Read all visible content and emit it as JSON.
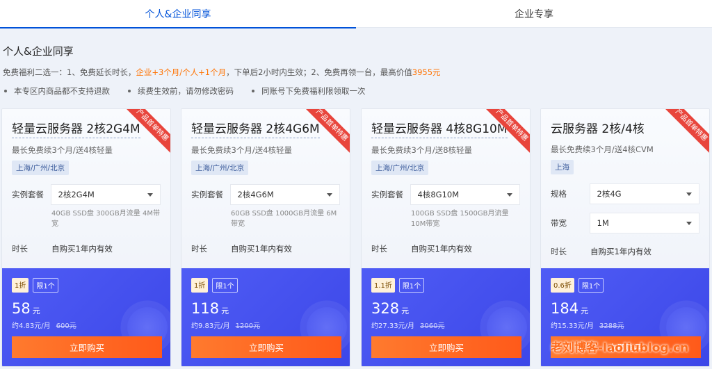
{
  "tabs": [
    {
      "label": "个人&企业同享",
      "active": true
    },
    {
      "label": "企业专享",
      "active": false
    }
  ],
  "section_title": "个人&企业同享",
  "benefit": {
    "prefix": "免费福利二选一：1、免费延长时长，",
    "highlight1": "企业+3个月/个人+1个月",
    "middle": "，下单后2小时内生效；2、免费再领一台，最高价值",
    "highlight2": "3955元"
  },
  "notes": [
    "本专区内商品都不支持退款",
    "续费生效前，请勿修改密码",
    "同账号下免费福利限领取一次"
  ],
  "ribbon_text": "产品首单特惠",
  "cards": [
    {
      "title": "轻量云服务器 2核2G4M",
      "subtitle": "最长免费续3个月/送4核轻量",
      "region": "上海/广州/北京",
      "spec_label": "实例套餐",
      "spec_value": "2核2G4M",
      "spec_desc": "40GB SSD盘 300GB月流量 4M带宽",
      "duration_label": "时长",
      "duration_value": "自购买1年内有效",
      "discount": "1折",
      "limit": "限1个",
      "price": "58",
      "price_unit": "元",
      "monthly": "约4.83元/月",
      "original": "600元",
      "buy_label": "立即购买"
    },
    {
      "title": "轻量云服务器 2核4G6M",
      "subtitle": "最长免费续3个月/送4核轻量",
      "region": "上海/广州/北京",
      "spec_label": "实例套餐",
      "spec_value": "2核4G6M",
      "spec_desc": "60GB SSD盘 1000GB月流量 6M带宽",
      "duration_label": "时长",
      "duration_value": "自购买1年内有效",
      "discount": "1折",
      "limit": "限1个",
      "price": "118",
      "price_unit": "元",
      "monthly": "约9.83元/月",
      "original": "1200元",
      "buy_label": "立即购买"
    },
    {
      "title": "轻量云服务器 4核8G10M",
      "subtitle": "最长免费续3个月/送8核轻量",
      "region": "上海/广州/北京",
      "spec_label": "实例套餐",
      "spec_value": "4核8G10M",
      "spec_desc": "100GB SSD盘 1500GB月流量 10M带宽",
      "duration_label": "时长",
      "duration_value": "自购买1年内有效",
      "discount": "1.1折",
      "limit": "限1个",
      "price": "328",
      "price_unit": "元",
      "monthly": "约27.33元/月",
      "original": "3060元",
      "buy_label": "立即购买"
    },
    {
      "title": "云服务器 2核/4核",
      "subtitle": "最长免费续3个月/送4核CVM",
      "region": "上海",
      "spec_label": "规格",
      "spec_value": "2核4G",
      "bw_label": "带宽",
      "bw_value": "1M",
      "duration_label": "时长",
      "duration_value": "自购买1年内有效",
      "discount": "0.6折",
      "limit": "限1个",
      "price": "184",
      "price_unit": "元",
      "monthly": "约15.33元/月",
      "original": "3288元",
      "buy_label": "立即购买"
    }
  ],
  "watermark": "老刘博客-laoliublog.cn",
  "colors": {
    "accent": "#0052d9",
    "highlight": "#ff7200",
    "price_panel": "#4552ef",
    "buy_button": "#ff6a22",
    "ribbon": "#e8453c"
  }
}
